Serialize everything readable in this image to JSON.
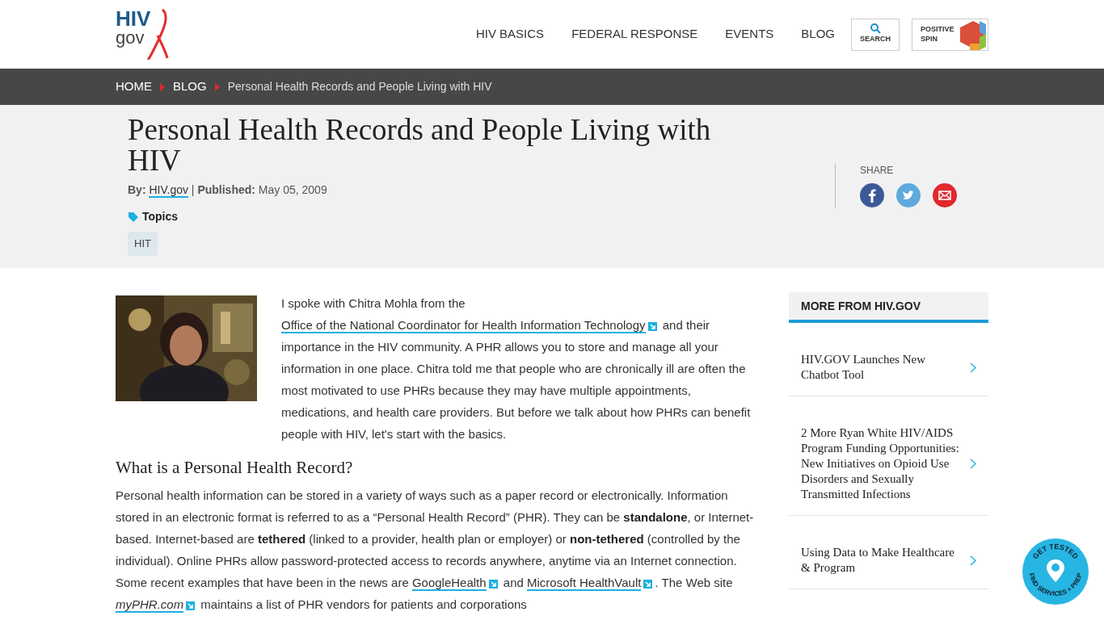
{
  "header": {
    "logo_top": "HIV",
    "logo_bottom": "gov",
    "nav": [
      {
        "label": "HIV BASICS"
      },
      {
        "label": "FEDERAL RESPONSE"
      },
      {
        "label": "EVENTS"
      },
      {
        "label": "BLOG"
      }
    ],
    "search": "SEARCH",
    "positive_spin": [
      "POSITIVE",
      "SPIN"
    ]
  },
  "breadcrumb": [
    {
      "label": "HOME",
      "kind": "link"
    },
    {
      "label": "BLOG",
      "kind": "link"
    },
    {
      "label": "Personal Health Records and People Living with HIV",
      "kind": "current"
    }
  ],
  "article": {
    "title": "Personal Health Records and People Living with HIV",
    "by_label": "By:",
    "author": "HIV.gov",
    "separator": "|",
    "published_label": "Published:",
    "date": "May 05, 2009",
    "topics_label": "Topics",
    "topics": [
      "HIT"
    ]
  },
  "share": {
    "label": "SHARE",
    "buttons": [
      {
        "kind": "facebook"
      },
      {
        "kind": "twitter"
      },
      {
        "kind": "email"
      }
    ]
  },
  "body": {
    "paragraphs": [
      [
        {
          "kind": "text",
          "text": "I spoke with Chitra Mohla from the "
        },
        {
          "kind": "link",
          "text": "Office of the National Coordinator for Health Information Technology"
        },
        {
          "kind": "text",
          "text": " and their importance in the HIV community. A PHR allows you to store and manage all your information in one place. Chitra told me that people who are chronically ill are often the most motivated to use PHRs because they may have multiple appointments, medications, and health care providers. But before we talk about how PHRs can benefit people with HIV, let's start with the basics."
        }
      ],
      [
        {
          "kind": "heading",
          "text": "What is a Personal Health Record?"
        }
      ],
      [
        {
          "kind": "text",
          "text": "Personal health information can be stored in a variety of ways such as a paper record or electronically. Information stored in an electronic format is referred to as a “Personal Health Record” (PHR). They can be "
        },
        {
          "kind": "bold",
          "text": "standalone"
        },
        {
          "kind": "text",
          "text": ", or Internet-based. Internet-based are "
        },
        {
          "kind": "bold",
          "text": "tethered"
        },
        {
          "kind": "text",
          "text": " (linked to a provider, health plan or employer) or "
        },
        {
          "kind": "bold",
          "text": "non-tethered"
        },
        {
          "kind": "text",
          "text": " (controlled by the individual). Online PHRs allow password-protected access to records anywhere, anytime via an Internet connection. Some recent examples that have been in the news are "
        },
        {
          "kind": "link",
          "text": "GoogleHealth"
        },
        {
          "kind": "text",
          "text": " and "
        },
        {
          "kind": "link",
          "text": "Microsoft HealthVault"
        },
        {
          "kind": "text",
          "text": ". The Web site "
        },
        {
          "kind": "italic_link",
          "text": "myPHR.com"
        },
        {
          "kind": "text",
          "text": " maintains a list of PHR vendors for patients and corporations"
        }
      ]
    ]
  },
  "sidebar": {
    "title": "MORE FROM HIV.GOV",
    "items": [
      {
        "title": "HIV.GOV Launches New Chatbot Tool"
      },
      {
        "title": "2 More Ryan White HIV/AIDS Program Funding Opportunities: New Initiatives on Opioid Use Disorders and Sexually Transmitted Infections"
      },
      {
        "title": "Using Data to Make Healthcare & Program"
      }
    ]
  },
  "badge": {
    "top": "GET TESTED",
    "bottom": "FIND SERVICES + PREP"
  }
}
